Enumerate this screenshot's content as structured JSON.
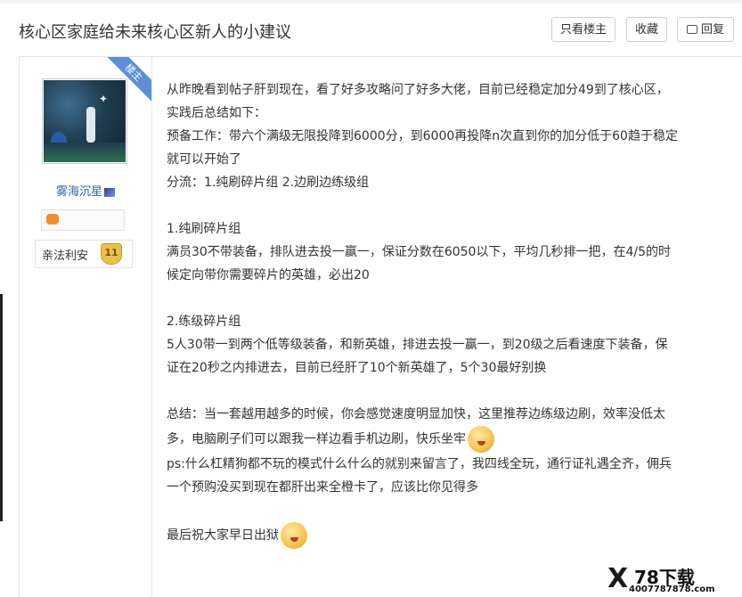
{
  "thread": {
    "title": "核心区家庭给未来核心区新人的小建议"
  },
  "toolbar": {
    "only_op_label": "只看楼主",
    "favorite_label": "收藏",
    "reply_label": "回复"
  },
  "author": {
    "badge": "楼主",
    "username": "雾海沉星",
    "level_name": "亲法利安",
    "level_number": "11"
  },
  "post": {
    "lines": [
      "从昨晚看到帖子肝到现在，看了好多攻略问了好多大佬，目前已经稳定加分49到了核心区，",
      "实践后总结如下：",
      "预备工作：带六个满级无限投降到6000分，到6000再投降n次直到你的加分低于60趋于稳定",
      "就可以开始了",
      "分流：1.纯刷碎片组 2.边刷边练级组",
      "",
      "1.纯刷碎片组",
      "满员30不带装备，排队进去投一赢一，保证分数在6050以下，平均几秒排一把，在4/5的时",
      "候定向带你需要碎片的英雄，必出20",
      "",
      "2.练级碎片组",
      "5人30带一到两个低等级装备，和新英雄，排进去投一赢一，到20级之后看速度下装备，保",
      "证在20秒之内排进去，目前已经肝了10个新英雄了，5个30最好别换",
      "",
      "总结：当一套越用越多的时候，你会感觉速度明显加快，这里推荐边练级边刷，效率没低太",
      "多，电脑刷子们可以跟我一样边看手机边刷，快乐坐牢",
      "ps:什么杠精狗都不玩的模式什么什么的就别来留言了，我四线全玩，通行证礼遇全齐，佣兵",
      "一个预购没买到现在都肝出来全橙卡了，应该比你见得多",
      "",
      "最后祝大家早日出狱"
    ]
  },
  "watermark": {
    "brand": "78下载",
    "phone": "4007787878.com"
  }
}
